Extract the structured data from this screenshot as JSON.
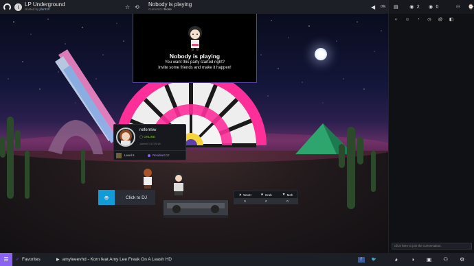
{
  "topbar": {
    "community_name": "LP Underground",
    "community_host": "Hosted by",
    "community_host_user": "jifar920",
    "now_playing_title": "Nobody is playing",
    "now_playing_dj_prefix": "Current DJ",
    "now_playing_dj": "None",
    "volume": "0%"
  },
  "sidebar": {
    "woot_count": "2",
    "grab_count": "0",
    "chat_placeholder": "Click here to join the conversation."
  },
  "video": {
    "title": "Nobody is playing",
    "line1": "You want this party started right?",
    "line2": "Invite some friends and make it happen!"
  },
  "user_card": {
    "username": "nefermiw",
    "status": "ONLINE",
    "joined": "Joined 7/27/2016",
    "level": "Level 6",
    "role": "Resident DJ"
  },
  "dj_button": {
    "label": "Click to DJ"
  },
  "votes": {
    "woot_label": "Woot!",
    "grab_label": "Grab",
    "meh_label": "Meh",
    "woot": "0",
    "grab": "0",
    "meh": "0"
  },
  "bottombar": {
    "playlist_name": "Favorites",
    "track": "amyleeevhd - Korn feat Amy Lee Freak On A Leash HD"
  }
}
